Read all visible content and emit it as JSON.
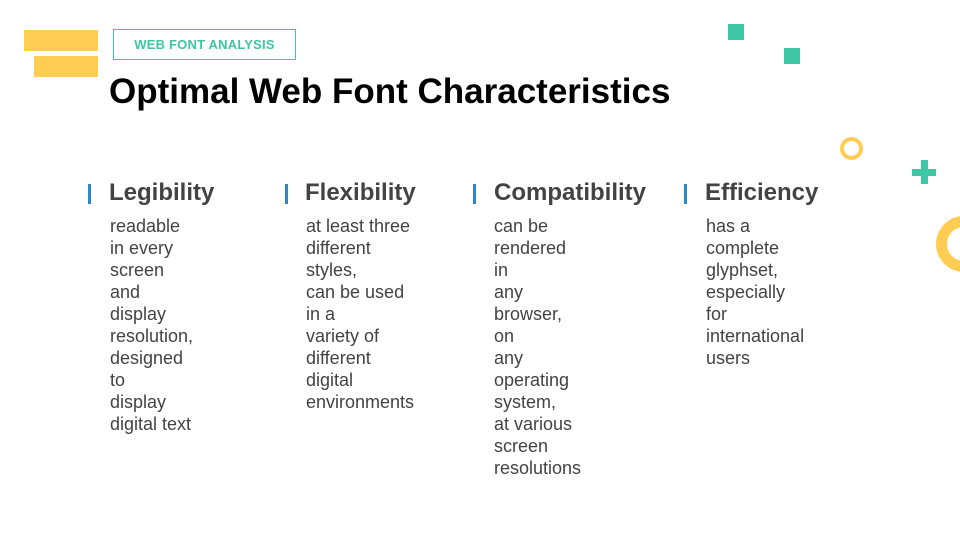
{
  "slide": {
    "tag_label": "WEB FONT ANALYSIS",
    "title": "Optimal Web Font Characteristics",
    "colors": {
      "accent_teal": "#3ec6a5",
      "accent_yellow": "#ffcd54",
      "accent_blue": "#2f87c9",
      "text_dark": "#434343"
    },
    "columns": [
      {
        "heading": "Legibility",
        "body": "readable in every\nscreen and\ndisplay resolution,\ndesigned to\ndisplay digital text"
      },
      {
        "heading": "Flexibility",
        "body": "at least three\ndifferent styles,\ncan be used in a\nvariety of\ndifferent digital\nenvironments"
      },
      {
        "heading": "Compatibility",
        "body": "can be rendered in\nany browser, on\nany operating\nsystem,\nat various screen\nresolutions"
      },
      {
        "heading": "Efficiency",
        "body": "has a complete\nglyphset,\nespecially for\ninternational users"
      }
    ]
  }
}
